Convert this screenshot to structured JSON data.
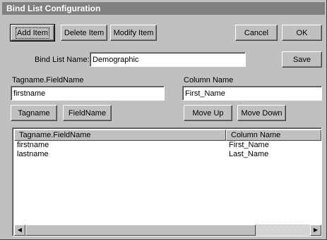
{
  "window": {
    "title": "Bind List Configuration"
  },
  "toolbar": {
    "add_item": "Add Item",
    "delete_item": "Delete Item",
    "modify_item": "Modify Item",
    "cancel": "Cancel",
    "ok": "OK"
  },
  "bind_list": {
    "name_label": "Bind List Name:",
    "name_value": "Demographic",
    "save": "Save"
  },
  "fields": {
    "tagname_label": "Tagname.FieldName",
    "tagname_value": "firstname",
    "column_label": "Column Name",
    "column_value": "First_Name"
  },
  "actions": {
    "tagname": "Tagname",
    "fieldname": "FieldName",
    "move_up": "Move Up",
    "move_down": "Move Down"
  },
  "table": {
    "columns": [
      "Tagname.FieldName",
      "Column Name"
    ],
    "rows": [
      [
        "firstname",
        "First_Name"
      ],
      [
        "lastname",
        "Last_Name"
      ]
    ]
  },
  "scrollbar": {
    "left_icon": "arrow-left-icon",
    "right_icon": "arrow-right-icon"
  }
}
